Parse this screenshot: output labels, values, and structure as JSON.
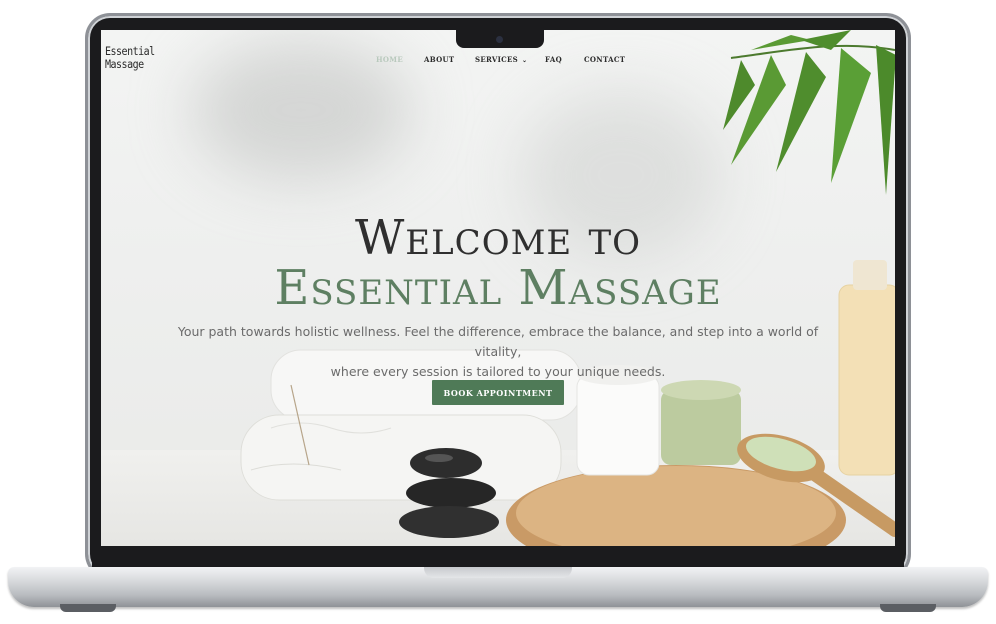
{
  "site": {
    "logo_line1": "Essential",
    "logo_line2": "Massage"
  },
  "nav": {
    "items": [
      {
        "label": "HOME"
      },
      {
        "label": "ABOUT"
      },
      {
        "label": "SERVICES"
      },
      {
        "label": "FAQ"
      },
      {
        "label": "CONTACT"
      }
    ]
  },
  "hero": {
    "title_line1": "Welcome to",
    "title_line2": "Essential Massage",
    "subtitle_line1": "Your path towards holistic wellness. Feel the difference, embrace the balance, and step into a world of vitality,",
    "subtitle_line2": "where every session is tailored to your unique needs.",
    "button_label": "BOOK APPOINTMENT"
  },
  "colors": {
    "accent_green": "#4f7a57",
    "title_dark": "#2f2f2f",
    "title_green": "#5e7f62",
    "nav_active": "#b9c9bd"
  },
  "icons": [
    "chevron-down-icon",
    "camera-icon"
  ]
}
